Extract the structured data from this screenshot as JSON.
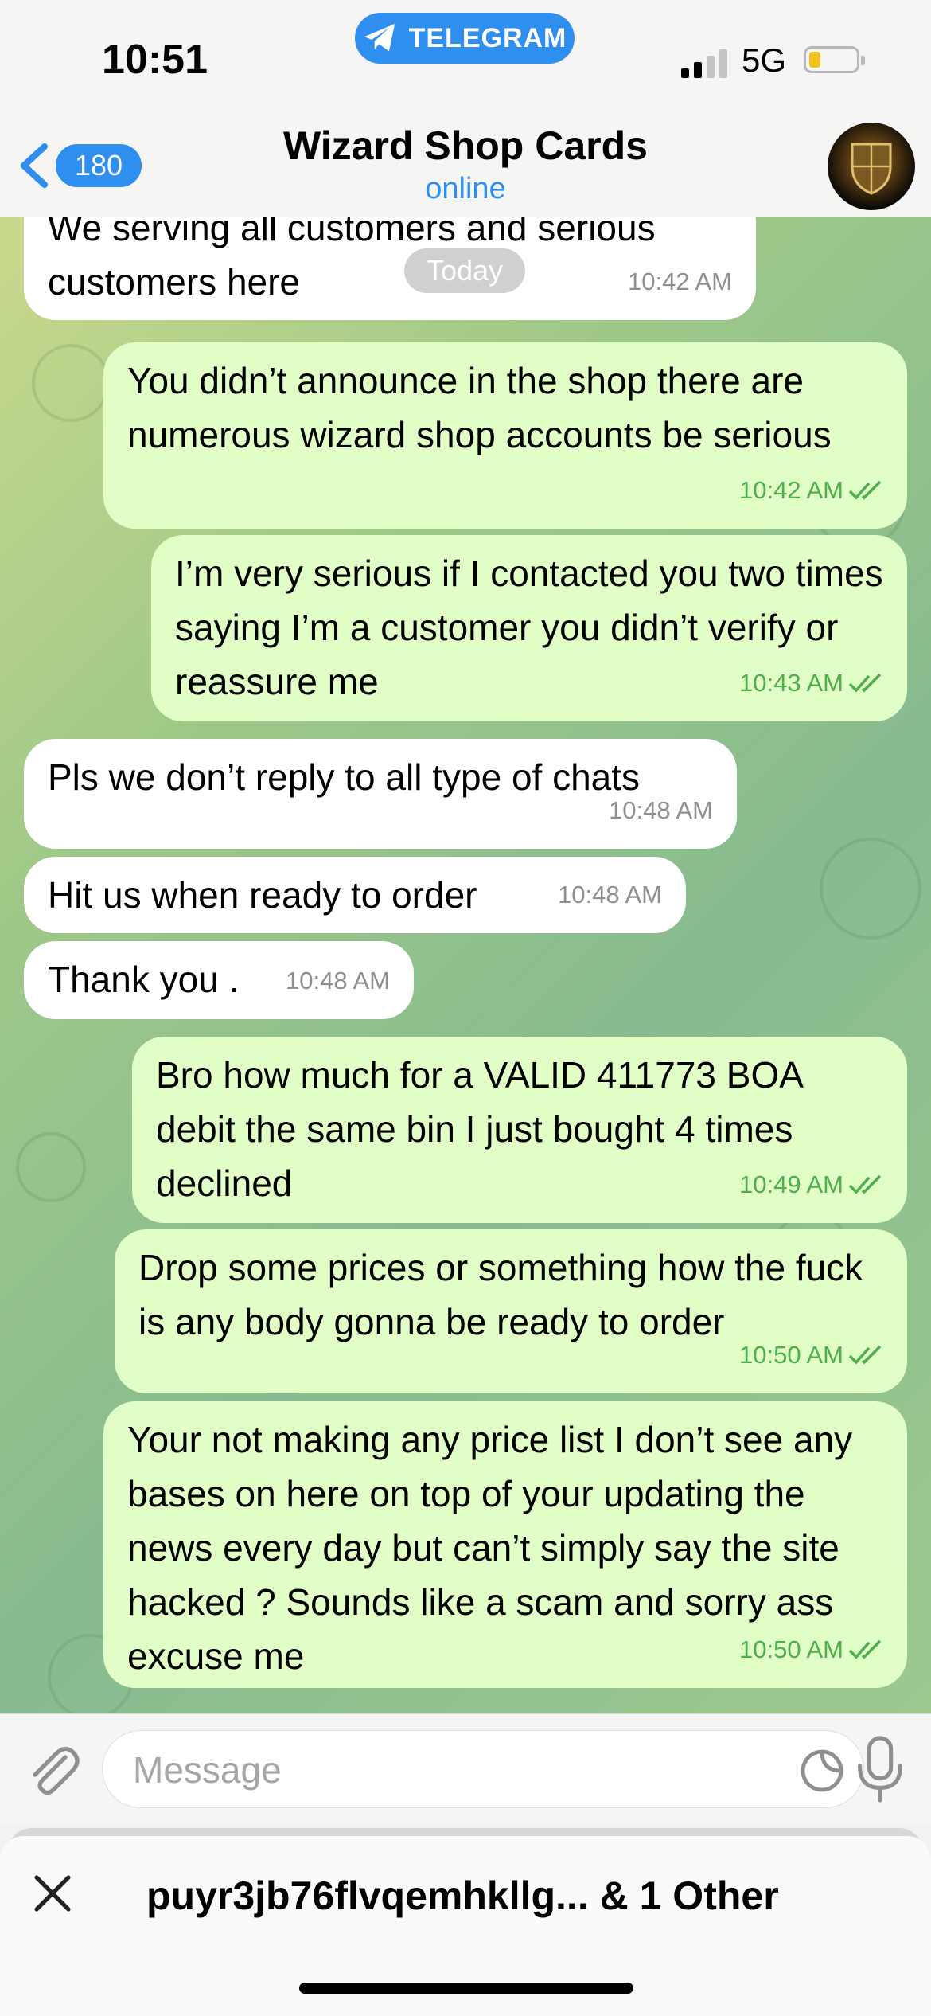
{
  "status_bar": {
    "time": "10:51",
    "network": "5G",
    "app_pill": "TELEGRAM"
  },
  "header": {
    "back_count": "180",
    "title": "Wizard Shop Cards",
    "subtitle": "online"
  },
  "date_chip": "Today",
  "messages": [
    {
      "dir": "in",
      "text": "We serving all customers and serious customers here",
      "time": "10:42 AM"
    },
    {
      "dir": "out",
      "text": "You didn’t announce in the shop there are numerous wizard shop accounts be serious",
      "time": "10:42 AM"
    },
    {
      "dir": "out",
      "text": "I’m very serious if I contacted you two times saying I’m a customer you didn’t verify or reassure me",
      "time": "10:43 AM"
    },
    {
      "dir": "in",
      "text": "Pls we don’t reply to all type of chats",
      "time": "10:48 AM"
    },
    {
      "dir": "in",
      "text": "Hit us when ready to order",
      "time": "10:48 AM"
    },
    {
      "dir": "in",
      "text": "Thank you .",
      "time": "10:48 AM"
    },
    {
      "dir": "out",
      "text": "Bro how much for a VALID 411773 BOA debit the same bin I just bought 4 times declined",
      "time": "10:49 AM"
    },
    {
      "dir": "out",
      "text": "Drop some prices or something how the fuck is any body gonna be ready to order",
      "time": "10:50 AM"
    },
    {
      "dir": "out",
      "text": "Your not making any price list I don’t see any bases on here on top of your updating the news every day but can’t simply say the site hacked ? Sounds like a scam and sorry ass excuse me",
      "time": "10:50 AM"
    }
  ],
  "input": {
    "placeholder": "Message"
  },
  "share_sheet": {
    "title": "puyr3jb76flvqemhkllg... & 1 Other"
  },
  "colors": {
    "accent": "#2f8ff0",
    "outgoing_bubble": "#e1fec6",
    "incoming_bubble": "#ffffff",
    "read_check": "#4fae4e"
  },
  "icons": [
    "telegram-plane-icon",
    "back-chevron-icon",
    "paperclip-icon",
    "sticker-icon",
    "microphone-icon",
    "close-icon",
    "double-check-icon"
  ]
}
